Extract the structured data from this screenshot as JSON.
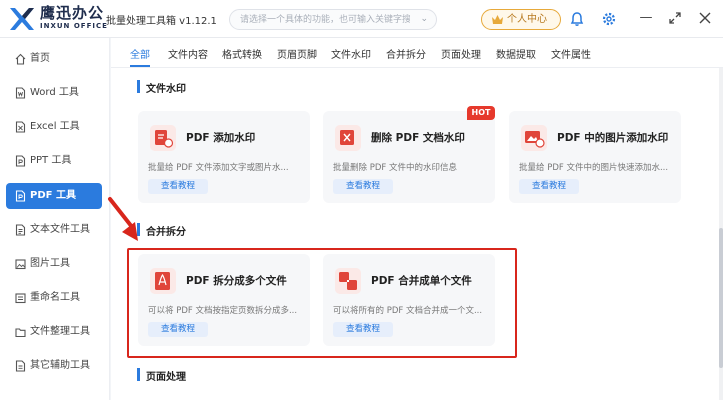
{
  "app": {
    "brand_name": "鹰迅办公",
    "brand_sub": "INXUN OFFICE",
    "title": "批量处理工具箱 v1.12.1"
  },
  "search": {
    "placeholder": "请选择一个具体的功能，也可输入关键字搜索！"
  },
  "member": {
    "label": "个人中心"
  },
  "colors": {
    "accent": "#2b7bde",
    "highlight_box": "#d8261c",
    "hot_badge": "#e6392c",
    "vip": "#e7a93a"
  },
  "sidebar": {
    "items": [
      {
        "label": "首页",
        "icon": "home-icon"
      },
      {
        "label": "Word 工具",
        "icon": "word-doc-icon"
      },
      {
        "label": "Excel 工具",
        "icon": "excel-doc-icon"
      },
      {
        "label": "PPT 工具",
        "icon": "ppt-doc-icon"
      },
      {
        "label": "PDF 工具",
        "icon": "pdf-doc-icon",
        "active": true
      },
      {
        "label": "文本文件工具",
        "icon": "text-file-icon"
      },
      {
        "label": "图片工具",
        "icon": "image-icon"
      },
      {
        "label": "重命名工具",
        "icon": "rename-icon"
      },
      {
        "label": "文件整理工具",
        "icon": "folder-icon"
      },
      {
        "label": "其它辅助工具",
        "icon": "misc-icon"
      }
    ]
  },
  "tabs": [
    "全部",
    "文件内容",
    "格式转换",
    "页眉页脚",
    "文件水印",
    "合并拆分",
    "页面处理",
    "数据提取",
    "文件属性"
  ],
  "sections": {
    "watermark": {
      "title": "文件水印",
      "cards": [
        {
          "title": "PDF 添加水印",
          "desc": "批量给 PDF 文件添加文字或图片水...",
          "button": "查看教程"
        },
        {
          "title": "删除 PDF 文档水印",
          "desc": "批量删除 PDF 文件中的水印信息",
          "button": "查看教程",
          "badge": "HOT"
        },
        {
          "title": "PDF 中的图片添加水印",
          "desc": "批量给 PDF 文件中的图片快速添加水...",
          "button": "查看教程"
        }
      ]
    },
    "merge_split": {
      "title": "合并拆分",
      "cards": [
        {
          "title": "PDF 拆分成多个文件",
          "desc": "可以将 PDF 文档按指定页数拆分成多...",
          "button": "查看教程"
        },
        {
          "title": "PDF 合并成单个文件",
          "desc": "可以将所有的 PDF 文档合并成一个文...",
          "button": "查看教程"
        }
      ]
    },
    "page_process": {
      "title": "页面处理"
    }
  }
}
